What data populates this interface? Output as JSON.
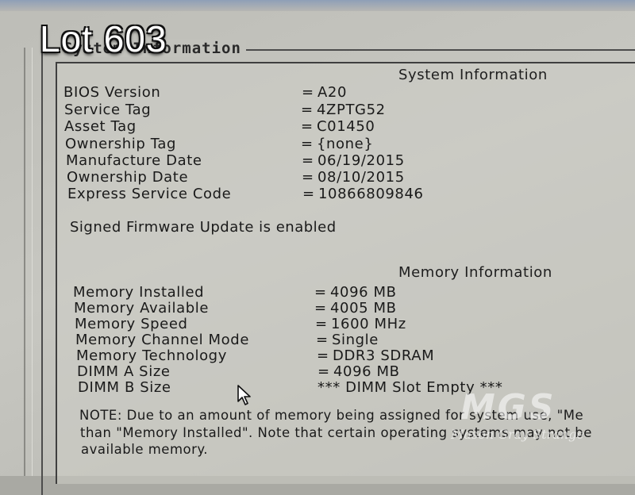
{
  "overlay": {
    "lot_label": "Lot 603"
  },
  "group_box": {
    "title": "System Information"
  },
  "system_information": {
    "heading": "System Information",
    "rows": [
      {
        "label": "BIOS Version",
        "value": "A20"
      },
      {
        "label": "Service Tag",
        "value": "4ZPTG52"
      },
      {
        "label": "Asset Tag",
        "value": "C01450"
      },
      {
        "label": "Ownership Tag",
        "value": "{none}"
      },
      {
        "label": "Manufacture Date",
        "value": "06/19/2015"
      },
      {
        "label": "Ownership Date",
        "value": "08/10/2015"
      },
      {
        "label": "Express Service Code",
        "value": "10866809846"
      }
    ],
    "equals": "=",
    "firmware_status": "Signed Firmware Update is enabled"
  },
  "memory_information": {
    "heading": "Memory Information",
    "rows": [
      {
        "label": "Memory Installed",
        "value": "4096 MB"
      },
      {
        "label": "Memory Available",
        "value": "4005 MB"
      },
      {
        "label": "Memory Speed",
        "value": "1600 MHz"
      },
      {
        "label": "Memory Channel Mode",
        "value": "Single"
      },
      {
        "label": "Memory Technology",
        "value": "DDR3 SDRAM"
      },
      {
        "label": "DIMM A Size",
        "value": "4096 MB"
      },
      {
        "label": "DIMM B Size",
        "value": "*** DIMM Slot Empty ***"
      }
    ],
    "note_lines": [
      "NOTE: Due to an amount of memory being assigned for system use, \"Me",
      "than \"Memory Installed\". Note that certain operating systems may not be",
      "available memory."
    ]
  },
  "watermark": {
    "logo": "MGS",
    "text": "Mason Gray Strange"
  }
}
